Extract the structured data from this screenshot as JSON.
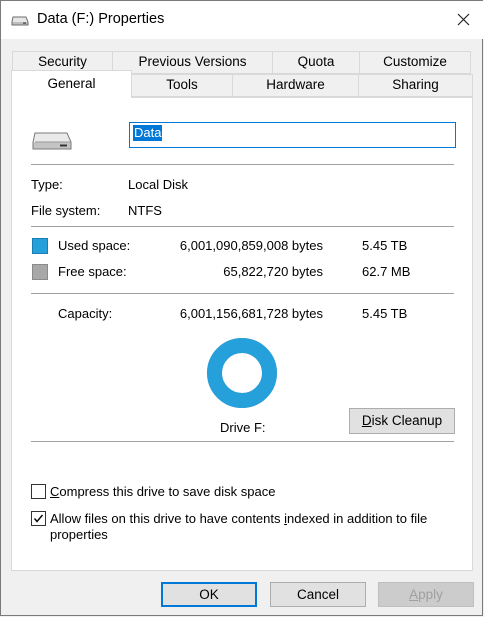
{
  "window": {
    "title": "Data (F:) Properties",
    "close_icon": "close-icon",
    "drive_icon": "drive-icon"
  },
  "tabs": {
    "row1": [
      {
        "label": "Security"
      },
      {
        "label": "Previous Versions"
      },
      {
        "label": "Quota"
      },
      {
        "label": "Customize"
      }
    ],
    "row2": [
      {
        "label": "General",
        "active": true
      },
      {
        "label": "Tools"
      },
      {
        "label": "Hardware"
      },
      {
        "label": "Sharing"
      }
    ]
  },
  "general": {
    "drive_name": "Data",
    "type_label": "Type:",
    "type_value": "Local Disk",
    "fs_label": "File system:",
    "fs_value": "NTFS",
    "used": {
      "label": "Used space:",
      "bytes": "6,001,090,859,008 bytes",
      "human": "5.45 TB",
      "color": "#26a0da"
    },
    "free": {
      "label": "Free space:",
      "bytes": "65,822,720 bytes",
      "human": "62.7 MB",
      "color": "#a8a8a8"
    },
    "capacity": {
      "label": "Capacity:",
      "bytes": "6,001,156,681,728 bytes",
      "human": "5.45 TB"
    },
    "used_fraction": 0.99999,
    "drive_label": "Drive F:",
    "disk_cleanup": {
      "pre": "",
      "underline": "D",
      "post": "isk Cleanup"
    },
    "compress": {
      "pre": "",
      "underline": "C",
      "post": "ompress this drive to save disk space",
      "checked": false
    },
    "index": {
      "pre": "Allow files on this drive to have contents ",
      "underline": "i",
      "post": "ndexed in addition to file",
      "line2": "properties",
      "checked": true
    }
  },
  "buttons": {
    "ok": "OK",
    "cancel": "Cancel",
    "apply": {
      "underline": "A",
      "post": "pply"
    }
  }
}
